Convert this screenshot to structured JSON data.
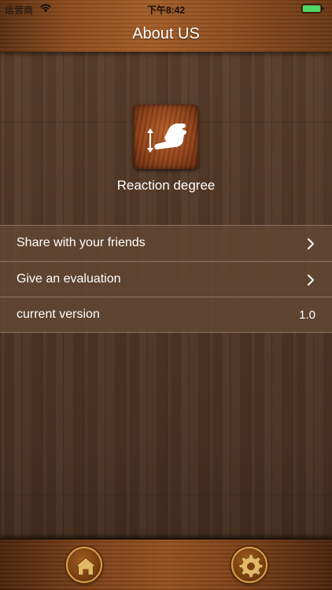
{
  "status_bar": {
    "carrier": "运营商",
    "time": "下午8:42",
    "battery_color": "#4cd964"
  },
  "header": {
    "title": "About US"
  },
  "app": {
    "icon": "swipe-hand-icon",
    "name": "Reaction degree"
  },
  "settings_list": {
    "items": [
      {
        "label": "Share with your friends",
        "icon": "chevron-right-icon"
      },
      {
        "label": "Give an evaluation",
        "icon": "chevron-right-icon"
      },
      {
        "label": "current version",
        "value": "1.0"
      }
    ]
  },
  "tab_bar": {
    "items": [
      {
        "icon": "home-icon"
      },
      {
        "icon": "gear-icon"
      }
    ]
  },
  "colors": {
    "header_wood": "#a35c25",
    "background_wood": "#523726",
    "list_background": "#624632",
    "tab_button_ring": "#d7a24a"
  }
}
